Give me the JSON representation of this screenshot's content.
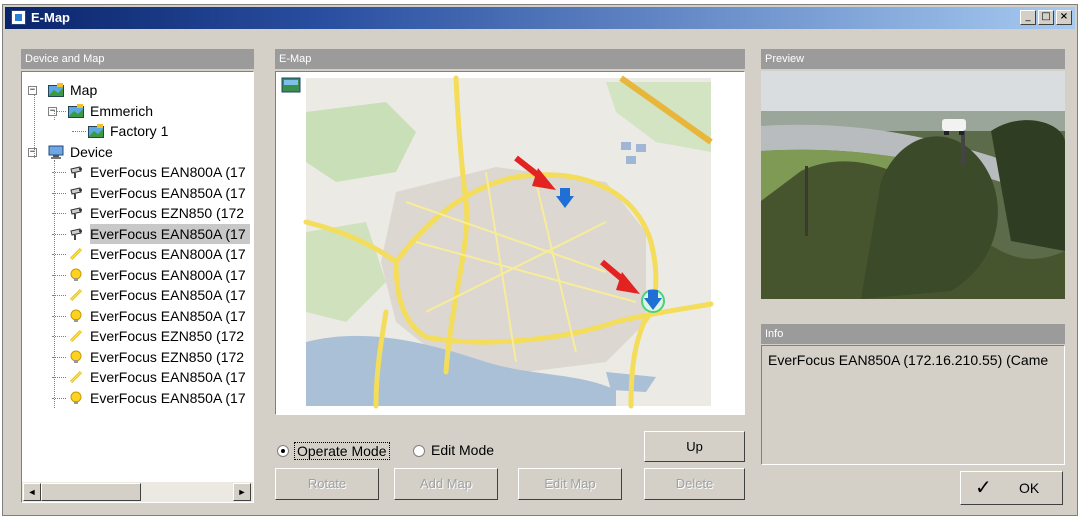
{
  "window": {
    "title": "E-Map",
    "minimize_glyph": "_",
    "maximize_glyph": "□",
    "close_glyph": "×"
  },
  "device_panel": {
    "header": "Device and Map",
    "tree": [
      {
        "label": "Map",
        "icon": "map-icon",
        "level": 0,
        "expander": "−"
      },
      {
        "label": "Emmerich",
        "icon": "map-icon",
        "level": 1,
        "expander": "−"
      },
      {
        "label": "Factory 1",
        "icon": "map-icon",
        "level": 2
      },
      {
        "label": "Device",
        "icon": "computer-icon",
        "level": 0,
        "expander": "−"
      },
      {
        "label": "EverFocus EAN800A (17",
        "icon": "camera-icon",
        "level": 1
      },
      {
        "label": "EverFocus EAN850A (17",
        "icon": "camera-icon",
        "level": 1
      },
      {
        "label": "EverFocus EZN850 (172",
        "icon": "camera-icon",
        "level": 1
      },
      {
        "label": "EverFocus EAN850A (17",
        "icon": "camera-icon",
        "level": 1,
        "selected": true
      },
      {
        "label": "EverFocus EAN800A (17",
        "icon": "sensor-icon",
        "level": 1
      },
      {
        "label": "EverFocus EAN800A (17",
        "icon": "alarm-bulb-icon",
        "level": 1
      },
      {
        "label": "EverFocus EAN850A (17",
        "icon": "sensor-icon",
        "level": 1
      },
      {
        "label": "EverFocus EAN850A (17",
        "icon": "alarm-bulb-icon",
        "level": 1
      },
      {
        "label": "EverFocus EZN850 (172",
        "icon": "sensor-icon",
        "level": 1
      },
      {
        "label": "EverFocus EZN850 (172",
        "icon": "alarm-bulb-icon",
        "level": 1
      },
      {
        "label": "EverFocus EAN850A (17",
        "icon": "sensor-icon",
        "level": 1
      },
      {
        "label": "EverFocus EAN850A (17",
        "icon": "alarm-bulb-icon",
        "level": 1
      }
    ],
    "scroll_left": "◄",
    "scroll_right": "►"
  },
  "emap_panel": {
    "header": "E-Map",
    "marker_count": 2,
    "mode": {
      "operate_label": "Operate Mode",
      "edit_label": "Edit Mode",
      "selected": "operate"
    },
    "buttons": {
      "up": "Up",
      "rotate": "Rotate",
      "add_map": "Add Map",
      "edit_map": "Edit Map",
      "delete": "Delete"
    }
  },
  "preview_panel": {
    "header": "Preview"
  },
  "info_panel": {
    "header": "Info",
    "text": "EverFocus EAN850A (172.16.210.55) (Came"
  },
  "ok_button": {
    "label": "OK",
    "check": "✓"
  },
  "colors": {
    "title_start": "#0a246a",
    "title_end": "#a6caf0",
    "panel_header": "#9b9b9b",
    "face": "#d4d0c8",
    "road": "#f6e26b",
    "water": "#a9c0d6",
    "urban": "#e6e2dc",
    "marker": "#1f6fd4",
    "arrow": "#e32222"
  }
}
